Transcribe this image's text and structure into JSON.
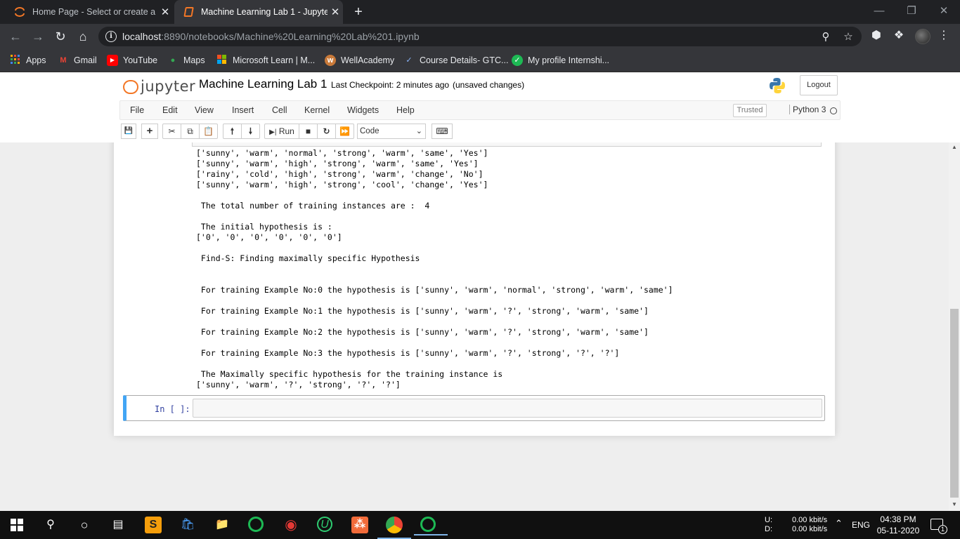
{
  "browser": {
    "tabs": [
      {
        "title": "Home Page - Select or create a n",
        "close": "✕"
      },
      {
        "title": "Machine Learning Lab 1 - Jupyter",
        "close": "✕"
      }
    ],
    "new_tab": "+",
    "url_host": "localhost",
    "url_path": ":8890/notebooks/Machine%20Learning%20Lab%201.ipynb",
    "bookmarks": [
      {
        "label": "Apps",
        "icon": "apps-grid-icon"
      },
      {
        "label": "Gmail",
        "icon": "gmail-icon"
      },
      {
        "label": "YouTube",
        "icon": "youtube-icon"
      },
      {
        "label": "Maps",
        "icon": "maps-icon"
      },
      {
        "label": "Microsoft Learn | M...",
        "icon": "microsoft-icon"
      },
      {
        "label": "WellAcademy",
        "icon": "wellacademy-icon"
      },
      {
        "label": "Course Details- GTC...",
        "icon": "course-icon"
      },
      {
        "label": "My profile Internshi...",
        "icon": "internshala-icon"
      }
    ]
  },
  "jupyter": {
    "logo_text": "jupyter",
    "notebook_name": "Machine Learning Lab 1",
    "checkpoint": "Last Checkpoint: 2 minutes ago",
    "autosave_status": "(unsaved changes)",
    "logout_label": "Logout",
    "menu": [
      "File",
      "Edit",
      "View",
      "Insert",
      "Cell",
      "Kernel",
      "Widgets",
      "Help"
    ],
    "trusted_label": "Trusted",
    "kernel_name": "Python 3",
    "run_label": "Run",
    "cell_type": "Code"
  },
  "output_lines": [
    "['sunny', 'warm', 'normal', 'strong', 'warm', 'same', 'Yes']",
    "['sunny', 'warm', 'high', 'strong', 'warm', 'same', 'Yes']",
    "['rainy', 'cold', 'high', 'strong', 'warm', 'change', 'No']",
    "['sunny', 'warm', 'high', 'strong', 'cool', 'change', 'Yes']",
    " The total number of training instances are :  4",
    " The initial hypothesis is : ",
    "['0', '0', '0', '0', '0', '0']",
    " Find-S: Finding maximally specific Hypothesis",
    " For training Example No:0 the hypothesis is ['sunny', 'warm', 'normal', 'strong', 'warm', 'same']",
    " For training Example No:1 the hypothesis is ['sunny', 'warm', '?', 'strong', 'warm', 'same']",
    " For training Example No:2 the hypothesis is ['sunny', 'warm', '?', 'strong', 'warm', 'same']",
    " For training Example No:3 the hypothesis is ['sunny', 'warm', '?', 'strong', '?', '?']",
    " The Maximally specific hypothesis for the training instance is",
    "['sunny', 'warm', '?', 'strong', '?', '?']"
  ],
  "empty_cell_prompt": "In [ ]:",
  "taskbar": {
    "net_labels": [
      "U:",
      "D:"
    ],
    "net_values": [
      "0.00 kbit/s",
      "0.00 kbit/s"
    ],
    "language": "ENG",
    "time": "04:38 PM",
    "date": "05-11-2020",
    "notification_count": "1"
  },
  "colors": {
    "jupyter_orange": "#f37726",
    "selected_cell_border": "#42a5f5",
    "prompt_blue": "#303f9f"
  }
}
